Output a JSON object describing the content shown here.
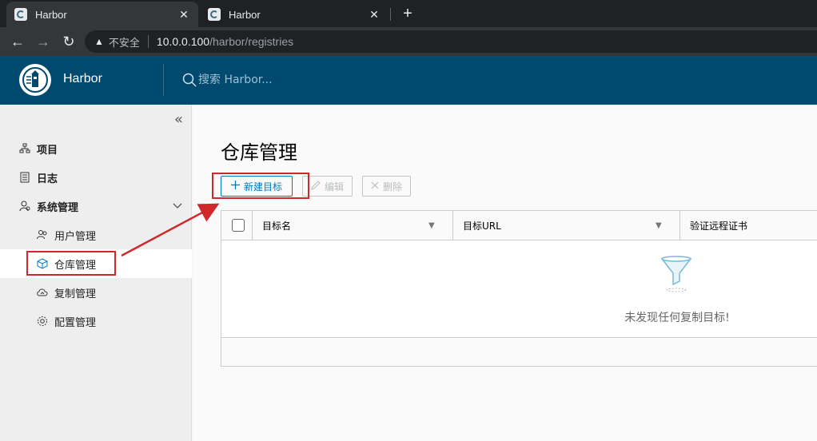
{
  "browser": {
    "tabs": [
      {
        "title": "Harbor",
        "active": true
      },
      {
        "title": "Harbor",
        "active": false
      }
    ],
    "close_glyph": "✕",
    "new_tab_glyph": "+",
    "address": {
      "security_label": "不安全",
      "url_host": "10.0.0.100",
      "url_path": "/harbor/registries"
    }
  },
  "header": {
    "brand": "Harbor",
    "search_placeholder": "搜索 Harbor..."
  },
  "sidebar": {
    "collapse_glyph": "«",
    "items": [
      {
        "label": "项目",
        "icon": "project-icon"
      },
      {
        "label": "日志",
        "icon": "log-icon"
      },
      {
        "label": "系统管理",
        "icon": "settings-user-icon",
        "expanded": true
      },
      {
        "label": "用户管理",
        "icon": "users-icon"
      },
      {
        "label": "仓库管理",
        "icon": "cube-icon",
        "active": true
      },
      {
        "label": "复制管理",
        "icon": "cloud-sync-icon"
      },
      {
        "label": "配置管理",
        "icon": "gear-icon"
      }
    ]
  },
  "main": {
    "title": "仓库管理",
    "toolbar": {
      "new_label": "新建目标",
      "edit_label": "编辑",
      "delete_label": "删除"
    },
    "grid": {
      "columns": [
        "目标名",
        "目标URL",
        "验证远程证书"
      ],
      "empty_text": "未发现任何复制目标!"
    }
  },
  "colors": {
    "header_bg": "#004a70",
    "primary": "#0079b8",
    "annotation_red": "#d0272b"
  }
}
